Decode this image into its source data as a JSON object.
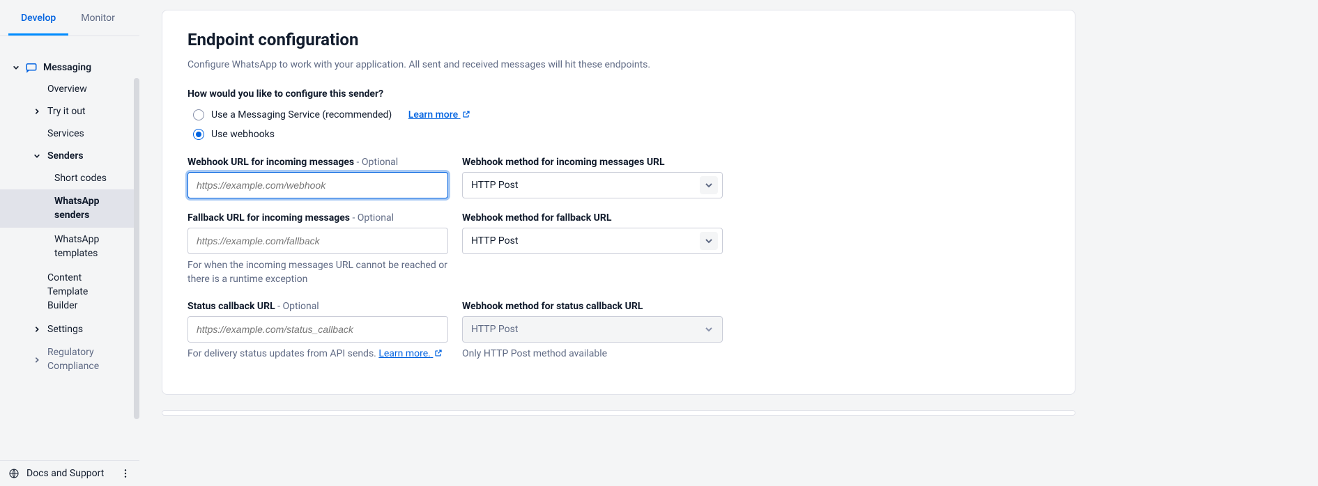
{
  "sidebar": {
    "tabs": {
      "develop": "Develop",
      "monitor": "Monitor"
    },
    "section": "Messaging",
    "items": {
      "overview": "Overview",
      "try": "Try it out",
      "services": "Services",
      "senders": "Senders",
      "short_codes": "Short codes",
      "whatsapp_senders": "WhatsApp senders",
      "whatsapp_templates": "WhatsApp templates",
      "content_template": "Content Template Builder",
      "settings": "Settings",
      "regulatory": "Regulatory Compliance"
    },
    "footer": {
      "docs": "Docs and Support"
    }
  },
  "page": {
    "title": "Endpoint configuration",
    "description": "Configure WhatsApp to work with your application. All sent and received messages will hit these endpoints.",
    "question": "How would you like to configure this sender?",
    "option_service": "Use a Messaging Service (recommended)",
    "learn_more": "Learn more",
    "option_webhooks": "Use webhooks",
    "fields": {
      "webhook_url": {
        "label": "Webhook URL for incoming messages",
        "optional": " - Optional",
        "placeholder": "https://example.com/webhook"
      },
      "webhook_method": {
        "label": "Webhook method for incoming messages URL",
        "value": "HTTP Post"
      },
      "fallback_url": {
        "label": "Fallback URL for incoming messages",
        "optional": " - Optional",
        "placeholder": "https://example.com/fallback",
        "help": "For when the incoming messages URL cannot be reached or there is a runtime exception"
      },
      "fallback_method": {
        "label": "Webhook method for fallback URL",
        "value": "HTTP Post"
      },
      "status_url": {
        "label": "Status callback URL",
        "optional": " - Optional",
        "placeholder": "https://example.com/status_callback",
        "help_prefix": "For delivery status updates from API sends. ",
        "help_link": "Learn more."
      },
      "status_method": {
        "label": "Webhook method for status callback URL",
        "value": "HTTP Post",
        "help": "Only HTTP Post method available"
      }
    }
  }
}
